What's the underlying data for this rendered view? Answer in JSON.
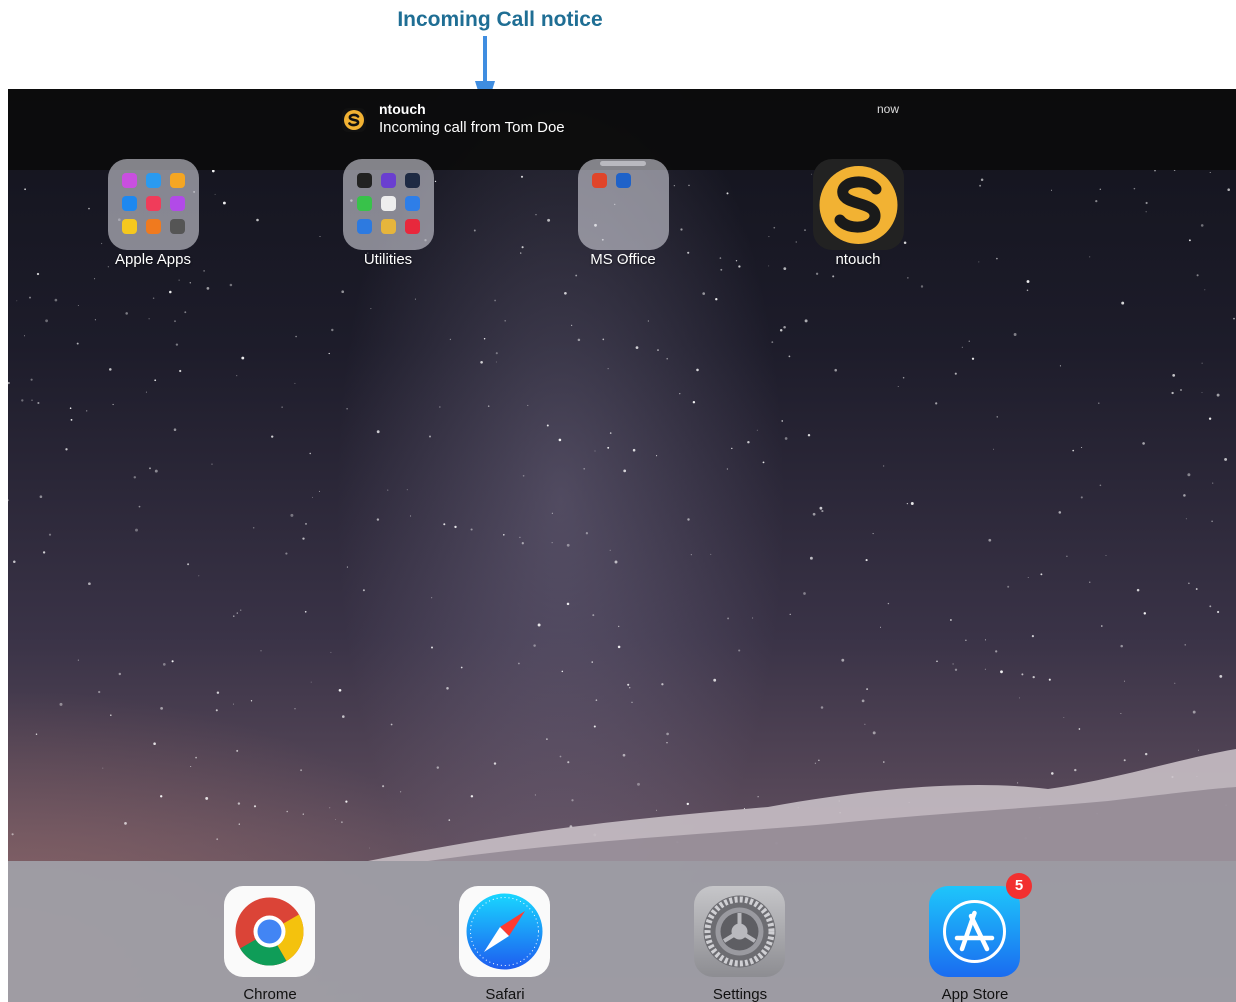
{
  "callout": {
    "text": "Incoming Call notice",
    "color": "#1f6e94",
    "arrow_color": "#3f8de0"
  },
  "notification": {
    "icon": "ntouch-s-logo-icon",
    "app_name": "ntouch",
    "message": "Incoming call from Tom Doe",
    "time": "now"
  },
  "home_screen": {
    "apps": [
      {
        "label": "Apple Apps",
        "type": "folder"
      },
      {
        "label": "Utilities",
        "type": "folder"
      },
      {
        "label": "MS Office",
        "type": "folder"
      },
      {
        "label": "ntouch",
        "type": "app",
        "icon": "ntouch-s-logo-icon"
      }
    ]
  },
  "dock": {
    "apps": [
      {
        "label": "Chrome",
        "icon": "chrome-icon"
      },
      {
        "label": "Safari",
        "icon": "safari-compass-icon"
      },
      {
        "label": "Settings",
        "icon": "settings-gear-icon"
      },
      {
        "label": "App Store",
        "icon": "app-store-icon",
        "badge": "5"
      }
    ]
  },
  "colors": {
    "badge": "#f23030",
    "ntouch_gold": "#f2b233",
    "dock": "#a0a0a8",
    "banner": "#0c0c0c"
  }
}
